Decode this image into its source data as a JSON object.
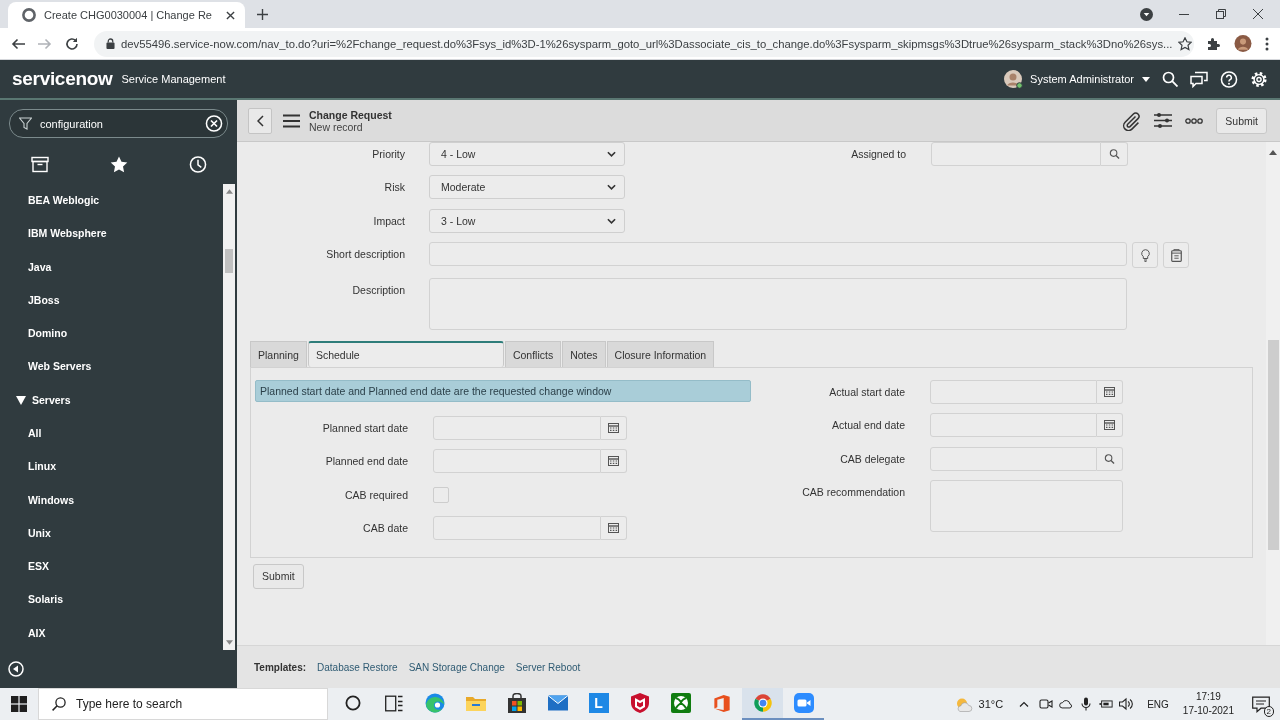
{
  "browser": {
    "tabs": [
      {
        "title": "Create CHG0030004 | Change Re",
        "selected": true
      }
    ],
    "url": "dev55496.service-now.com/nav_to.do?uri=%2Fchange_request.do%3Fsys_id%3D-1%26sysparm_goto_url%3Dassociate_cis_to_change.do%3Fsysparm_skipmsgs%3Dtrue%26sysparm_stack%3Dno%26sys..."
  },
  "header": {
    "logo": "servicenow",
    "product": "Service Management",
    "user": "System Administrator"
  },
  "nav": {
    "filter": "configuration",
    "items": [
      {
        "label": "BEA Weblogic"
      },
      {
        "label": "IBM Websphere"
      },
      {
        "label": "Java"
      },
      {
        "label": "JBoss"
      },
      {
        "label": "Domino"
      },
      {
        "label": "Web Servers"
      },
      {
        "label": "Servers",
        "expanded": true,
        "children": [
          {
            "label": "All"
          },
          {
            "label": "Linux"
          },
          {
            "label": "Windows"
          },
          {
            "label": "Unix"
          },
          {
            "label": "ESX"
          },
          {
            "label": "Solaris"
          },
          {
            "label": "AIX"
          }
        ]
      }
    ]
  },
  "record": {
    "title": "Change Request",
    "subtitle": "New record",
    "action": "Submit"
  },
  "form": {
    "left": [
      {
        "kind": "select",
        "label": "Priority",
        "value": "4 - Low"
      },
      {
        "kind": "select",
        "label": "Risk",
        "value": "Moderate"
      },
      {
        "kind": "select",
        "label": "Impact",
        "value": "3 - Low"
      }
    ],
    "right": [
      {
        "kind": "reference",
        "label": "Assigned to"
      }
    ],
    "wide": [
      {
        "kind": "suggest",
        "label": "Short description"
      },
      {
        "kind": "textarea",
        "label": "Description"
      }
    ]
  },
  "tabs": [
    {
      "label": "Planning",
      "selected": false
    },
    {
      "label": "Schedule",
      "selected": true
    },
    {
      "label": "Conflicts",
      "selected": false
    },
    {
      "label": "Notes",
      "selected": false
    },
    {
      "label": "Closure Information",
      "selected": false
    }
  ],
  "schedule": {
    "note": "Planned start date and Planned end date are the requested change window",
    "left": [
      {
        "kind": "date",
        "label": "Planned start date"
      },
      {
        "kind": "date",
        "label": "Planned end date"
      },
      {
        "kind": "checkbox",
        "label": "CAB required",
        "checked": false
      },
      {
        "kind": "date",
        "label": "CAB date"
      }
    ],
    "right": [
      {
        "kind": "date",
        "label": "Actual start date"
      },
      {
        "kind": "date",
        "label": "Actual end date"
      },
      {
        "kind": "reference",
        "label": "CAB delegate"
      },
      {
        "kind": "textarea",
        "label": "CAB recommendation"
      }
    ]
  },
  "submit": "Submit",
  "templates": {
    "label": "Templates:",
    "links": [
      "Database Restore",
      "SAN Storage Change",
      "Server Reboot"
    ]
  },
  "taskbar": {
    "search": {
      "placeholder": "Type here to search"
    },
    "apps": [
      {
        "kind": "circle",
        "selected": false,
        "running": false
      },
      {
        "kind": "panes",
        "selected": false,
        "running": false
      },
      {
        "kind": "wave",
        "selected": false,
        "running": false
      },
      {
        "kind": "folder",
        "selected": false,
        "running": false
      },
      {
        "kind": "bag",
        "selected": false,
        "running": false
      },
      {
        "kind": "mail",
        "selected": false,
        "running": false
      },
      {
        "kind": "tile",
        "label": "L",
        "selected": false,
        "running": false
      },
      {
        "kind": "shield",
        "selected": false,
        "running": false
      },
      {
        "kind": "gamepad",
        "selected": false,
        "running": false
      },
      {
        "kind": "office",
        "selected": false,
        "running": false
      },
      {
        "kind": "browser",
        "selected": true,
        "running": true
      },
      {
        "kind": "camera",
        "selected": false,
        "running": true
      }
    ],
    "weather": "31°C",
    "language": "ENG",
    "time": "17:19",
    "date": "17-10-2021",
    "notifications": "2"
  }
}
